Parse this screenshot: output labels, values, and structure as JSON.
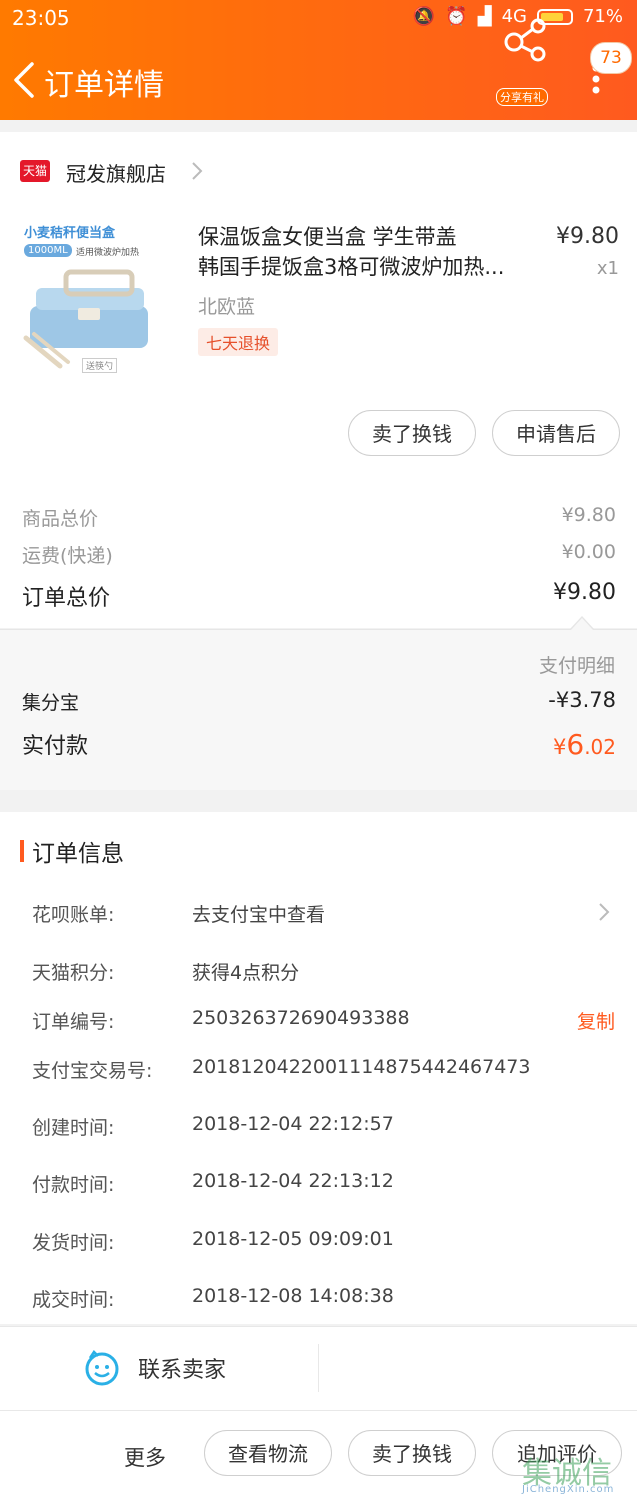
{
  "status_bar": {
    "time": "23:05",
    "network": "4G",
    "battery": "71%"
  },
  "header": {
    "title": "订单详情",
    "share_label": "分享有礼",
    "badge": "73"
  },
  "shop": {
    "logo_text": "天猫",
    "name": "冠发旗舰店"
  },
  "product": {
    "title_line1": "保温饭盒女便当盒 学生带盖",
    "title_line2": "韩国手提饭盒3格可微波炉加热...",
    "price": "¥9.80",
    "quantity": "x1",
    "variant": "北欧蓝",
    "tag": "七天退换",
    "image_caption": "小麦秸秆便当盒",
    "image_capacity": "1000ML",
    "image_sub": "适用微波炉加热",
    "image_gift": "送筷勺"
  },
  "actions": {
    "sell": "卖了换钱",
    "after_sale": "申请售后"
  },
  "summary": {
    "goods_label": "商品总价",
    "goods_value": "¥9.80",
    "shipping_label": "运费(快递)",
    "shipping_value": "¥0.00",
    "total_label": "订单总价",
    "total_value": "¥9.80"
  },
  "payment": {
    "detail_link": "支付明细",
    "jifenbao_label": "集分宝",
    "jifenbao_value": "-¥3.78",
    "paid_label": "实付款",
    "paid_currency": "¥",
    "paid_int": "6",
    "paid_dec": ".02"
  },
  "order_info": {
    "section_title": "订单信息",
    "rows": [
      {
        "label": "花呗账单:",
        "value": "去支付宝中查看"
      },
      {
        "label": "天猫积分:",
        "value": "获得4点积分"
      },
      {
        "label": "订单编号:",
        "value": "250326372690493388"
      },
      {
        "label": "支付宝交易号:",
        "value": "2018120422001114875442467473"
      },
      {
        "label": "创建时间:",
        "value": "2018-12-04 22:12:57"
      },
      {
        "label": "付款时间:",
        "value": "2018-12-04 22:13:12"
      },
      {
        "label": "发货时间:",
        "value": "2018-12-05 09:09:01"
      },
      {
        "label": "成交时间:",
        "value": "2018-12-08 14:08:38"
      }
    ],
    "copy_label": "复制"
  },
  "contact": {
    "label": "联系卖家"
  },
  "bottom_bar": {
    "more": "更多",
    "logistics": "查看物流",
    "sell": "卖了换钱",
    "review": "追加评价"
  },
  "watermark": {
    "text": "JiChengXin.com",
    "glyph": "集诚信"
  },
  "colors": {
    "brand": "#ff6a00",
    "accent": "#ff5a1f",
    "muted": "#999999"
  }
}
